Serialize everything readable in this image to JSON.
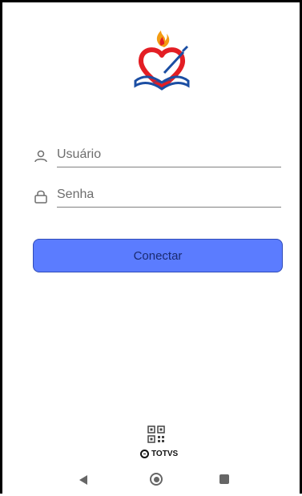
{
  "login": {
    "username_placeholder": "Usuário",
    "password_placeholder": "Senha",
    "connect_label": "Conectar"
  },
  "footer": {
    "brand_text": "TOTVS"
  },
  "logo": {
    "colors": {
      "heart": "#e31e24",
      "book": "#1b4ea3",
      "flame": "#f39c12"
    }
  },
  "icons": {
    "user": "user-icon",
    "lock": "lock-icon",
    "qr": "qr-code-icon",
    "back": "back-icon",
    "home": "home-icon",
    "recent": "recent-apps-icon"
  },
  "colors": {
    "button_bg": "#5b7cff",
    "button_border": "#2f4bb8",
    "button_text": "#1a2a70",
    "text_muted": "#6d6d6d"
  }
}
